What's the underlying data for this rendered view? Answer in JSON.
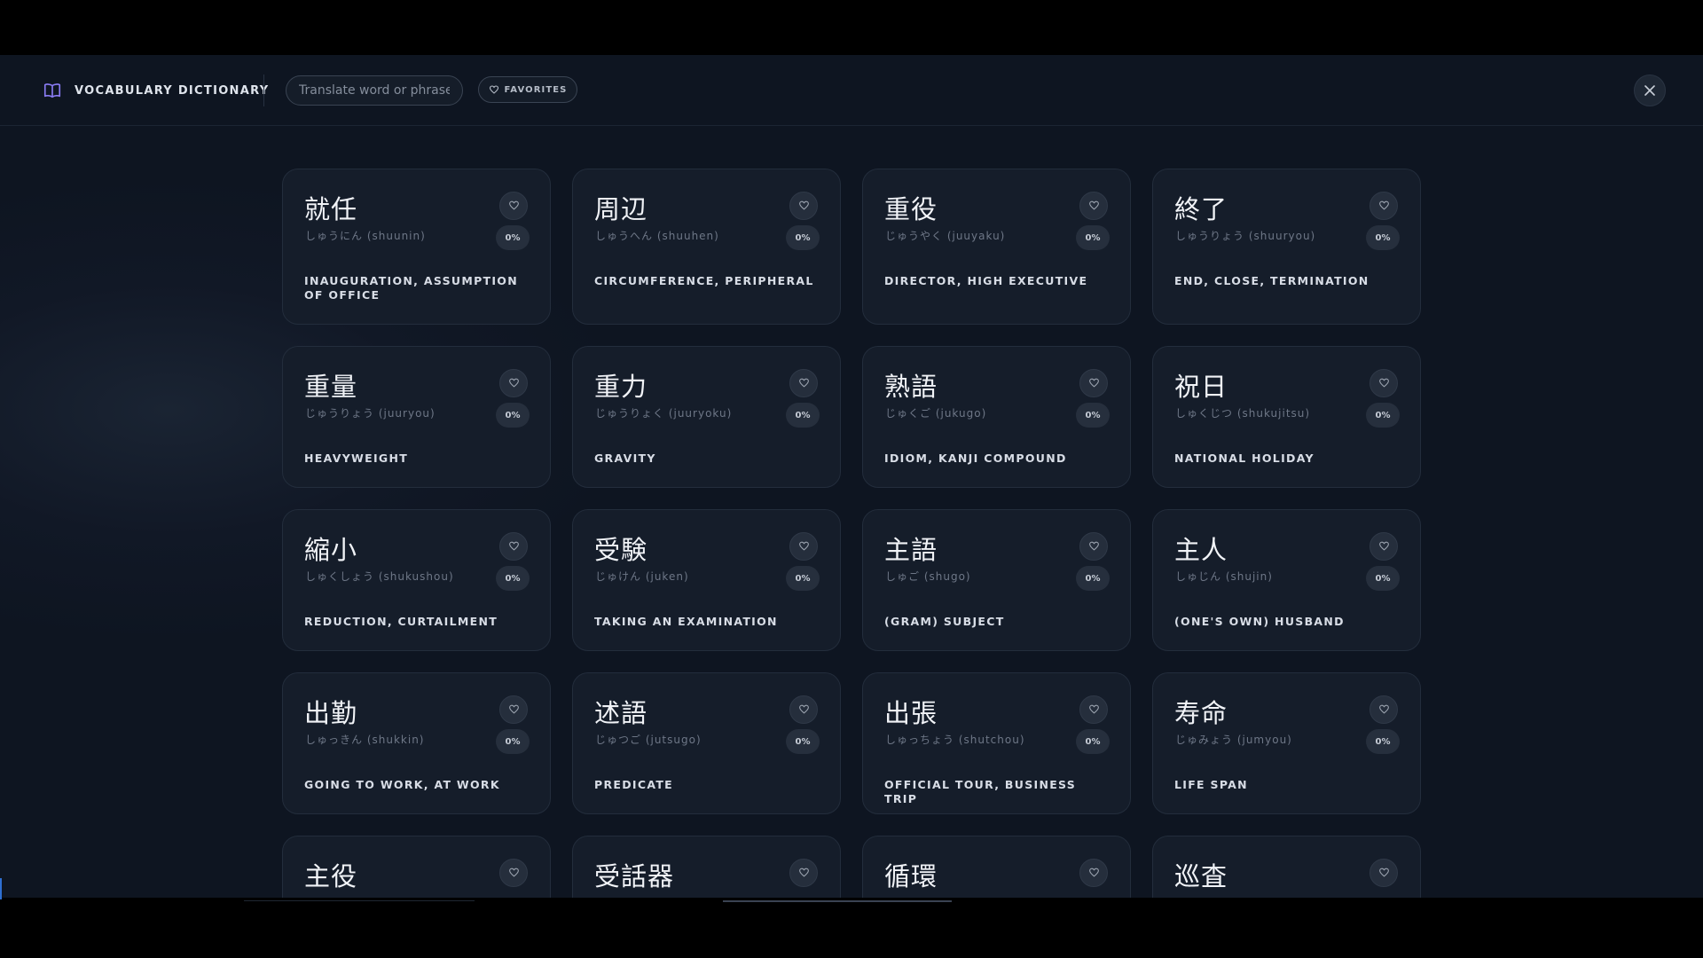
{
  "header": {
    "title": "VOCABULARY DICTIONARY",
    "search_placeholder": "Translate word or phrase",
    "favorites_label": "FAVORITES"
  },
  "colors": {
    "accent": "#7c6cf0",
    "background": "#111826",
    "card": "#151d2a"
  },
  "cards": [
    {
      "word": "就任",
      "reading": "しゅうにん (shuunin)",
      "progress": "0%",
      "meaning": "INAUGURATION, ASSUMPTION OF OFFICE"
    },
    {
      "word": "周辺",
      "reading": "しゅうへん (shuuhen)",
      "progress": "0%",
      "meaning": "CIRCUMFERENCE, PERIPHERAL"
    },
    {
      "word": "重役",
      "reading": "じゅうやく (juuyaku)",
      "progress": "0%",
      "meaning": "DIRECTOR, HIGH EXECUTIVE"
    },
    {
      "word": "終了",
      "reading": "しゅうりょう (shuuryou)",
      "progress": "0%",
      "meaning": "END, CLOSE, TERMINATION"
    },
    {
      "word": "重量",
      "reading": "じゅうりょう (juuryou)",
      "progress": "0%",
      "meaning": "HEAVYWEIGHT"
    },
    {
      "word": "重力",
      "reading": "じゅうりょく (juuryoku)",
      "progress": "0%",
      "meaning": "GRAVITY"
    },
    {
      "word": "熟語",
      "reading": "じゅくご (jukugo)",
      "progress": "0%",
      "meaning": "IDIOM, KANJI COMPOUND"
    },
    {
      "word": "祝日",
      "reading": "しゅくじつ (shukujitsu)",
      "progress": "0%",
      "meaning": "NATIONAL HOLIDAY"
    },
    {
      "word": "縮小",
      "reading": "しゅくしょう (shukushou)",
      "progress": "0%",
      "meaning": "REDUCTION, CURTAILMENT"
    },
    {
      "word": "受験",
      "reading": "じゅけん (juken)",
      "progress": "0%",
      "meaning": "TAKING AN EXAMINATION"
    },
    {
      "word": "主語",
      "reading": "しゅご (shugo)",
      "progress": "0%",
      "meaning": "(GRAM) SUBJECT"
    },
    {
      "word": "主人",
      "reading": "しゅじん (shujin)",
      "progress": "0%",
      "meaning": "(ONE'S OWN) HUSBAND"
    },
    {
      "word": "出勤",
      "reading": "しゅっきん (shukkin)",
      "progress": "0%",
      "meaning": "GOING TO WORK, AT WORK"
    },
    {
      "word": "述語",
      "reading": "じゅつご (jutsugo)",
      "progress": "0%",
      "meaning": "PREDICATE"
    },
    {
      "word": "出張",
      "reading": "しゅっちょう (shutchou)",
      "progress": "0%",
      "meaning": "OFFICIAL TOUR, BUSINESS TRIP"
    },
    {
      "word": "寿命",
      "reading": "じゅみょう (jumyou)",
      "progress": "0%",
      "meaning": "LIFE SPAN"
    },
    {
      "word": "主役",
      "reading": "",
      "progress": "",
      "meaning": ""
    },
    {
      "word": "受話器",
      "reading": "",
      "progress": "",
      "meaning": ""
    },
    {
      "word": "循環",
      "reading": "",
      "progress": "",
      "meaning": ""
    },
    {
      "word": "巡査",
      "reading": "",
      "progress": "",
      "meaning": ""
    }
  ]
}
